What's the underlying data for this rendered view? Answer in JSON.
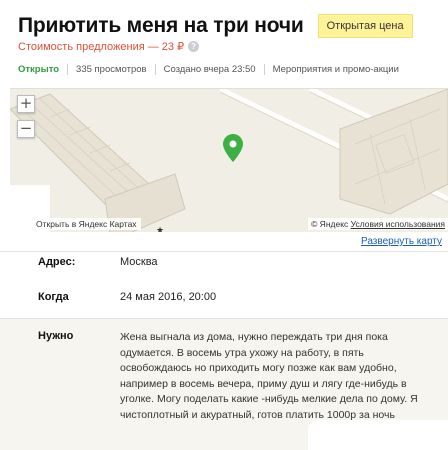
{
  "listing": {
    "title": "Приютить меня на три ночи",
    "price_badge": "Открытая цена",
    "price_line": "Стоимость предложения — 23 ₽",
    "help_icon": "?"
  },
  "meta": {
    "status": "Открыто",
    "views": "335 просмотров",
    "created": "Создано вчера 23:50",
    "category": "Мероприятия и промо-акции"
  },
  "map": {
    "zoom_in": "+",
    "zoom_out": "−",
    "open_link": "Открыть в Яндекс Картах",
    "attribution_copy": "© Яндекс",
    "attribution_terms": "Условия использования",
    "pin_color": "#3cb043",
    "star": "★",
    "expand_link": "Развернуть карту"
  },
  "details": {
    "address_label": "Адрес:",
    "address_value": "Москва",
    "date_label": "Когда",
    "date_value": "24 мая 2016, 20:00",
    "need_label": "Нужно",
    "need_text": "Жена выгнала из дома, нужно переждать три дня пока одумается. В восемь утра ухожу на работу, в пять освобождаюсь но приходить могу позже как вам удобно, например в восемь вечера, приму душ и лягу где-нибудь в уголке. Могу поделать какие -нибудь мелкие дела по дому. Я чистоплотный и акуратный, готов платить 1000р за ночь"
  },
  "colors": {
    "status_green": "#2f9e3a",
    "price_red": "#e0503a",
    "badge_yellow": "#fff39a",
    "link_blue": "#1a5fb4"
  }
}
